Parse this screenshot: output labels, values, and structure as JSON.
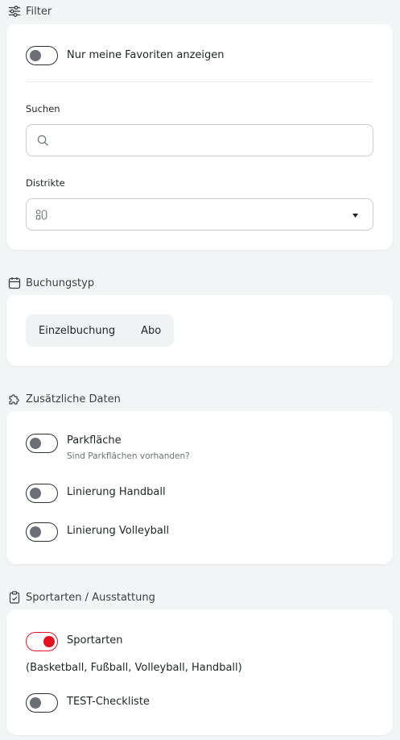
{
  "filter": {
    "title": "Filter",
    "favorites_label": "Nur meine Favoriten anzeigen",
    "favorites_on": false,
    "search_label": "Suchen",
    "search_value": "",
    "district_label": "Distrikte",
    "district_value": ""
  },
  "booking": {
    "title": "Buchungstyp",
    "options": [
      "Einzelbuchung",
      "Abo"
    ]
  },
  "extra": {
    "title": "Zusätzliche Daten",
    "items": [
      {
        "label": "Parkfläche",
        "sublabel": "Sind Parkflächen vorhanden?",
        "on": false
      },
      {
        "label": "Linierung Handball",
        "on": false
      },
      {
        "label": "Linierung Volleyball",
        "on": false
      }
    ]
  },
  "sports": {
    "title": "Sportarten / Ausstattung",
    "items": [
      {
        "label": "Sportarten",
        "on": true,
        "detail": "(Basketball, Fußball, Volleyball, Handball)"
      },
      {
        "label": "TEST-Checkliste",
        "on": false
      }
    ]
  },
  "colors": {
    "accent": "#e3121f",
    "knob_off": "#6b7077",
    "background": "#f3f4f6"
  }
}
